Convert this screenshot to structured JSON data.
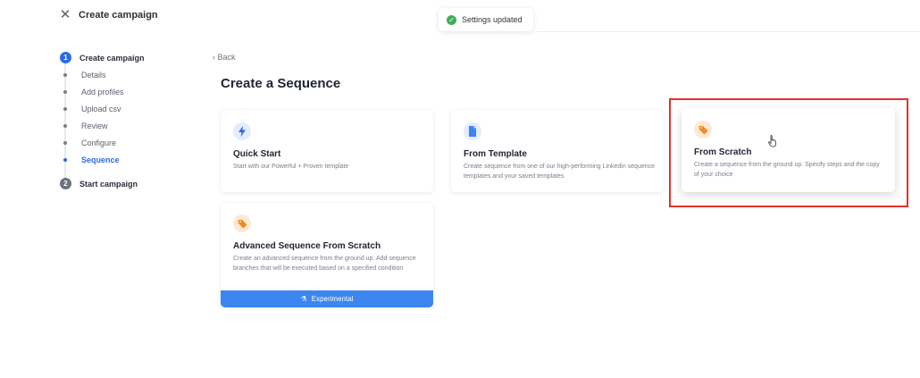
{
  "header": {
    "title": "Create campaign"
  },
  "toast": {
    "text": "Settings updated"
  },
  "stepper": {
    "step1": {
      "number": "1",
      "label": "Create campaign"
    },
    "substeps": [
      "Details",
      "Add profiles",
      "Upload csv",
      "Review",
      "Configure",
      "Sequence"
    ],
    "step2": {
      "number": "2",
      "label": "Start campaign"
    }
  },
  "main": {
    "back_label": "Back",
    "title": "Create a Sequence",
    "cards": [
      {
        "title": "Quick Start",
        "description": "Start with our Powerful + Proven template",
        "icon": "bolt-icon"
      },
      {
        "title": "From Template",
        "description": "Create sequence from one of our high-performing Linkedin sequence templates and your saved templates",
        "icon": "document-icon"
      },
      {
        "title": "From Scratch",
        "description": "Create a sequence from the ground up. Specify steps and the copy of your choice",
        "icon": "tag-icon"
      },
      {
        "title": "Advanced Sequence From Scratch",
        "description": "Create an advanced sequence from the ground up. Add sequence branches that will be executed based on a specified condition",
        "icon": "tag-icon",
        "badge": "Experimental"
      }
    ]
  },
  "colors": {
    "accent": "#2d6be4",
    "highlight": "#e53127",
    "success": "#3fae5a",
    "experimental": "#3b86f0"
  }
}
